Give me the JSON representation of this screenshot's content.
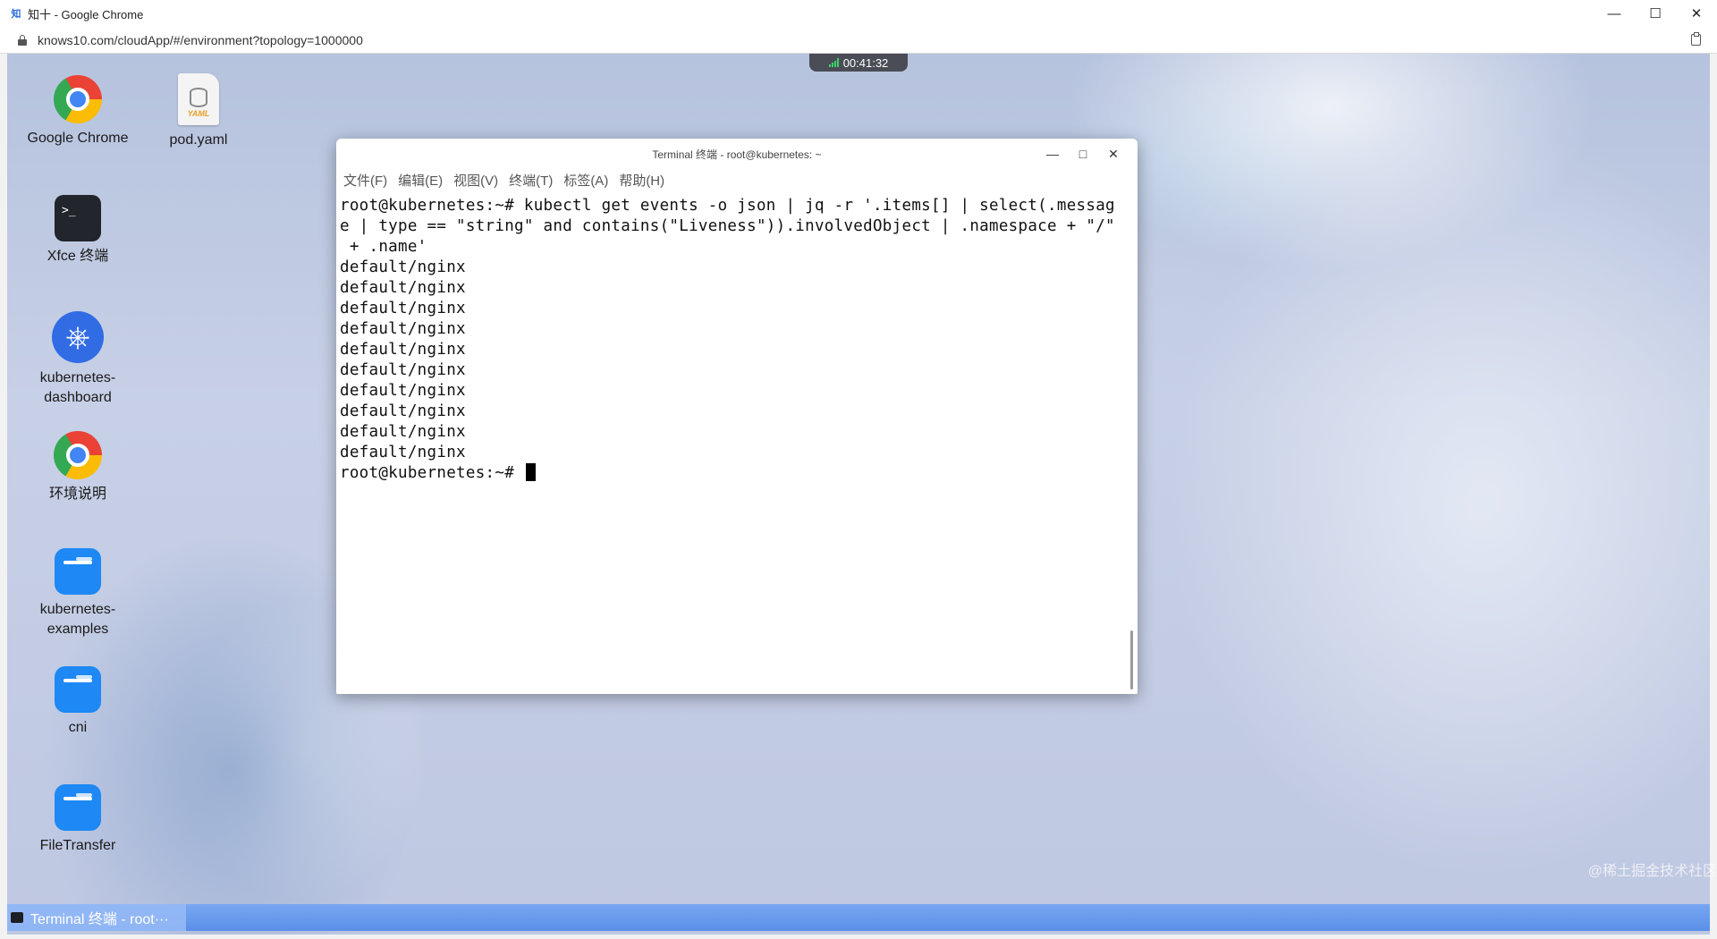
{
  "browser": {
    "tab_icon_text": "知",
    "window_title": "知十 - Google Chrome",
    "url": "knows10.com/cloudApp/#/environment?topology=1000000",
    "controls": {
      "minimize": "—",
      "maximize": "☐",
      "close": "✕"
    }
  },
  "remote": {
    "timer": "00:41:32"
  },
  "desktop_icons": [
    {
      "label": "Google Chrome",
      "icon": "chrome-icon"
    },
    {
      "label": "pod.yaml",
      "icon": "yaml-file-icon",
      "badge": "YAML"
    },
    {
      "label": "Xfce 终端",
      "icon": "terminal-icon",
      "glyph": ">_"
    },
    {
      "label": "kubernetes-\ndashboard",
      "icon": "kubernetes-icon",
      "glyph": "⎈"
    },
    {
      "label": "环境说明",
      "icon": "chrome-icon"
    },
    {
      "label": "kubernetes-\nexamples",
      "icon": "folder-icon"
    },
    {
      "label": "cni",
      "icon": "folder-icon"
    },
    {
      "label": "FileTransfer",
      "icon": "folder-icon"
    }
  ],
  "terminal": {
    "title": "Terminal 终端 - root@kubernetes: ~",
    "controls": {
      "minimize": "—",
      "maximize": "□",
      "close": "✕"
    },
    "menu": [
      "文件(F)",
      "编辑(E)",
      "视图(V)",
      "终端(T)",
      "标签(A)",
      "帮助(H)"
    ],
    "lines": [
      "root@kubernetes:~# kubectl get events -o json | jq -r '.items[] | select(.messag",
      "e | type == \"string\" and contains(\"Liveness\")).involvedObject | .namespace + \"/\"",
      " + .name'",
      "default/nginx",
      "default/nginx",
      "default/nginx",
      "default/nginx",
      "default/nginx",
      "default/nginx",
      "default/nginx",
      "default/nginx",
      "default/nginx",
      "default/nginx"
    ],
    "prompt": "root@kubernetes:~# "
  },
  "taskbar": {
    "task_label": "Terminal 终端 - root···"
  },
  "watermark": "@稀土掘金技术社区"
}
